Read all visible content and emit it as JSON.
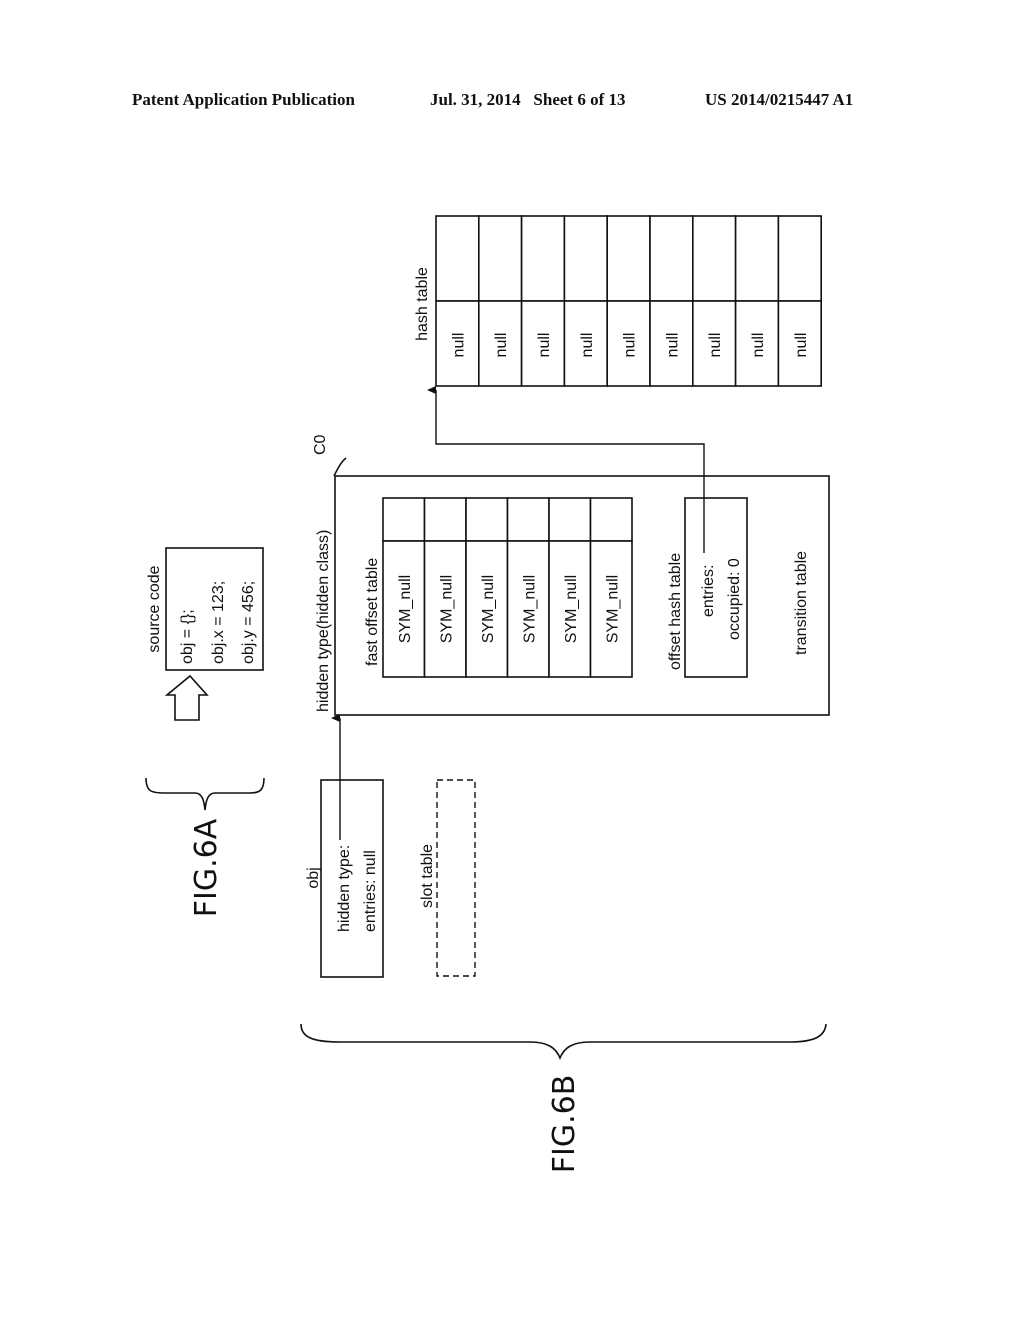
{
  "header": {
    "publication": "Patent Application Publication",
    "date_sheet": "Jul. 31, 2014   Sheet 6 of 13",
    "patent_number": "US 2014/0215447 A1"
  },
  "fig6a": {
    "label": "FIG.6A",
    "source_code": {
      "title": "source code",
      "lines": [
        "obj = {};",
        "obj.x = 123;",
        "obj.y = 456;"
      ]
    }
  },
  "fig6b": {
    "label": "FIG.6B",
    "obj": {
      "title": "obj",
      "lines": [
        "hidden type:",
        "entries: null"
      ]
    },
    "slot_table": {
      "title": "slot table"
    },
    "hidden_class": {
      "title": "hidden type(hidden class)",
      "ref": "C0",
      "fast_offset_table": {
        "title": "fast offset table",
        "cells": [
          "SYM_null",
          "SYM_null",
          "SYM_null",
          "SYM_null",
          "SYM_null",
          "SYM_null"
        ]
      },
      "offset_hash_table": {
        "title": "offset hash table",
        "lines": [
          "entries:",
          "occupied: 0"
        ]
      },
      "transition_table": {
        "title": "transition table"
      }
    },
    "hash_table": {
      "title": "hash table",
      "cells": [
        "null",
        "null",
        "null",
        "null",
        "null",
        "null",
        "null",
        "null",
        "null"
      ]
    }
  }
}
